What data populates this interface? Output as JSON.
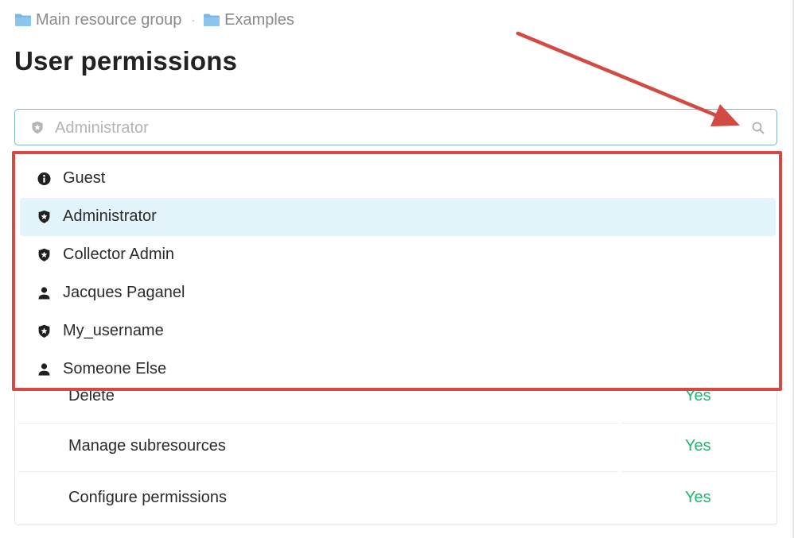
{
  "breadcrumb": {
    "items": [
      {
        "label": "Main resource group",
        "icon": "folder-icon"
      },
      {
        "label": "Examples",
        "icon": "folder-icon"
      }
    ],
    "separator": "·"
  },
  "page_title": "User permissions",
  "search": {
    "placeholder": "Administrator",
    "value": "",
    "role_icon": "shield-star-icon",
    "trailing_icon": "search-icon"
  },
  "dropdown": {
    "items": [
      {
        "label": "Guest",
        "icon": "info-circle-icon",
        "selected": false
      },
      {
        "label": "Administrator",
        "icon": "shield-star-icon",
        "selected": true
      },
      {
        "label": "Collector Admin",
        "icon": "shield-star-icon",
        "selected": false
      },
      {
        "label": "Jacques Paganel",
        "icon": "person-icon",
        "selected": false
      },
      {
        "label": "My_username",
        "icon": "shield-star-icon",
        "selected": false
      },
      {
        "label": "Someone Else",
        "icon": "person-icon",
        "selected": false
      }
    ]
  },
  "permissions": {
    "rows": [
      {
        "name": "Delete",
        "value": "Yes"
      },
      {
        "name": "Manage subresources",
        "value": "Yes"
      },
      {
        "name": "Configure permissions",
        "value": "Yes"
      }
    ]
  },
  "colors": {
    "accent_border": "#7fb3cf",
    "selected_bg": "#e4f4fb",
    "yes_green": "#22b573",
    "annotation_red": "#d24a43",
    "folder_blue": "#7cb8e4"
  }
}
